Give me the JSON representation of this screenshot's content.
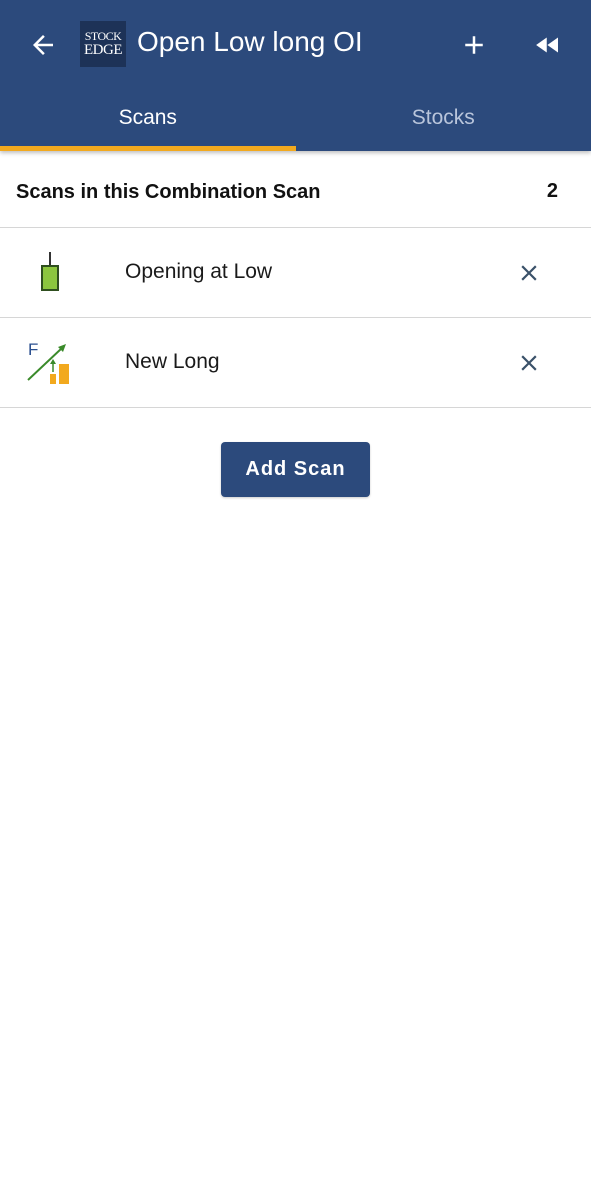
{
  "header": {
    "title": "Open Low long OI",
    "logo": {
      "line1": "STOCK",
      "line2": "EDGE"
    },
    "back_icon": "arrow-left-icon",
    "add_icon": "plus-icon",
    "rewind_icon": "rewind-icon",
    "background_color": "#2c4a7c"
  },
  "tabs": [
    {
      "label": "Scans",
      "active": true
    },
    {
      "label": "Stocks",
      "active": false
    }
  ],
  "accent_color": "#f2a91e",
  "section": {
    "title": "Scans in this Combination Scan",
    "count": "2"
  },
  "scans": [
    {
      "label": "Opening at Low",
      "icon": "candle-icon"
    },
    {
      "label": "New Long",
      "icon": "futures-long-icon",
      "icon_letter": "F"
    }
  ],
  "add_scan_label": "Add Scan"
}
